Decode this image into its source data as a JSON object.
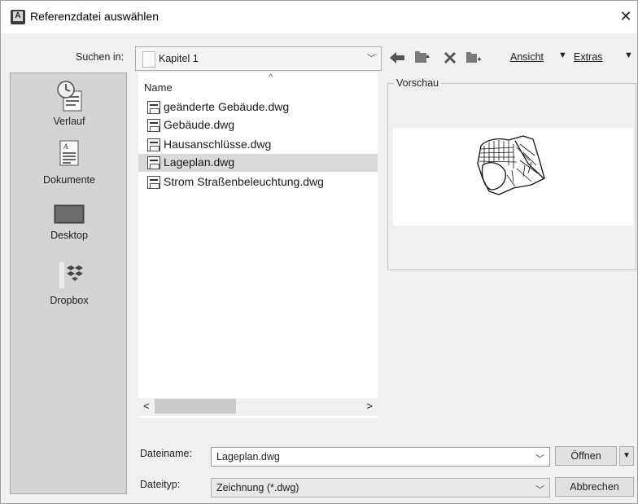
{
  "window": {
    "title": "Referenzdatei auswählen",
    "close_glyph": "✕"
  },
  "toolbar": {
    "lookin_label": "Suchen in:",
    "folder": "Kapitel 1",
    "icons": [
      "back-arrow-icon",
      "up-folder-icon",
      "delete-icon",
      "new-folder-icon"
    ],
    "view_menu": "Ansicht",
    "tools_menu": "Extras"
  },
  "places": [
    {
      "label": "Verlauf",
      "icon": "history-icon"
    },
    {
      "label": "Dokumente",
      "icon": "documents-icon"
    },
    {
      "label": "Desktop",
      "icon": "desktop-icon"
    },
    {
      "label": "Dropbox",
      "icon": "dropbox-icon"
    }
  ],
  "filelist": {
    "column_header": "Name",
    "files": [
      {
        "name": "geänderte Gebäude.dwg",
        "selected": false
      },
      {
        "name": "Gebäude.dwg",
        "selected": false
      },
      {
        "name": "Hausanschlüsse.dwg",
        "selected": false
      },
      {
        "name": "Lageplan.dwg",
        "selected": true
      },
      {
        "name": "Strom Straßenbeleuchtung.dwg",
        "selected": false
      }
    ],
    "scroll_left": "<",
    "scroll_right": ">"
  },
  "preview": {
    "label": "Vorschau"
  },
  "bottom": {
    "filename_label": "Dateiname:",
    "filename_value": "Lageplan.dwg",
    "filetype_label": "Dateityp:",
    "filetype_value": "Zeichnung (*.dwg)",
    "open_button": "Öffnen",
    "cancel_button": "Abbrechen"
  },
  "colors": {
    "panel": "#d4d4d4",
    "selected_row": "#d9d9d9",
    "dialog_bg": "#f0f0f0"
  }
}
